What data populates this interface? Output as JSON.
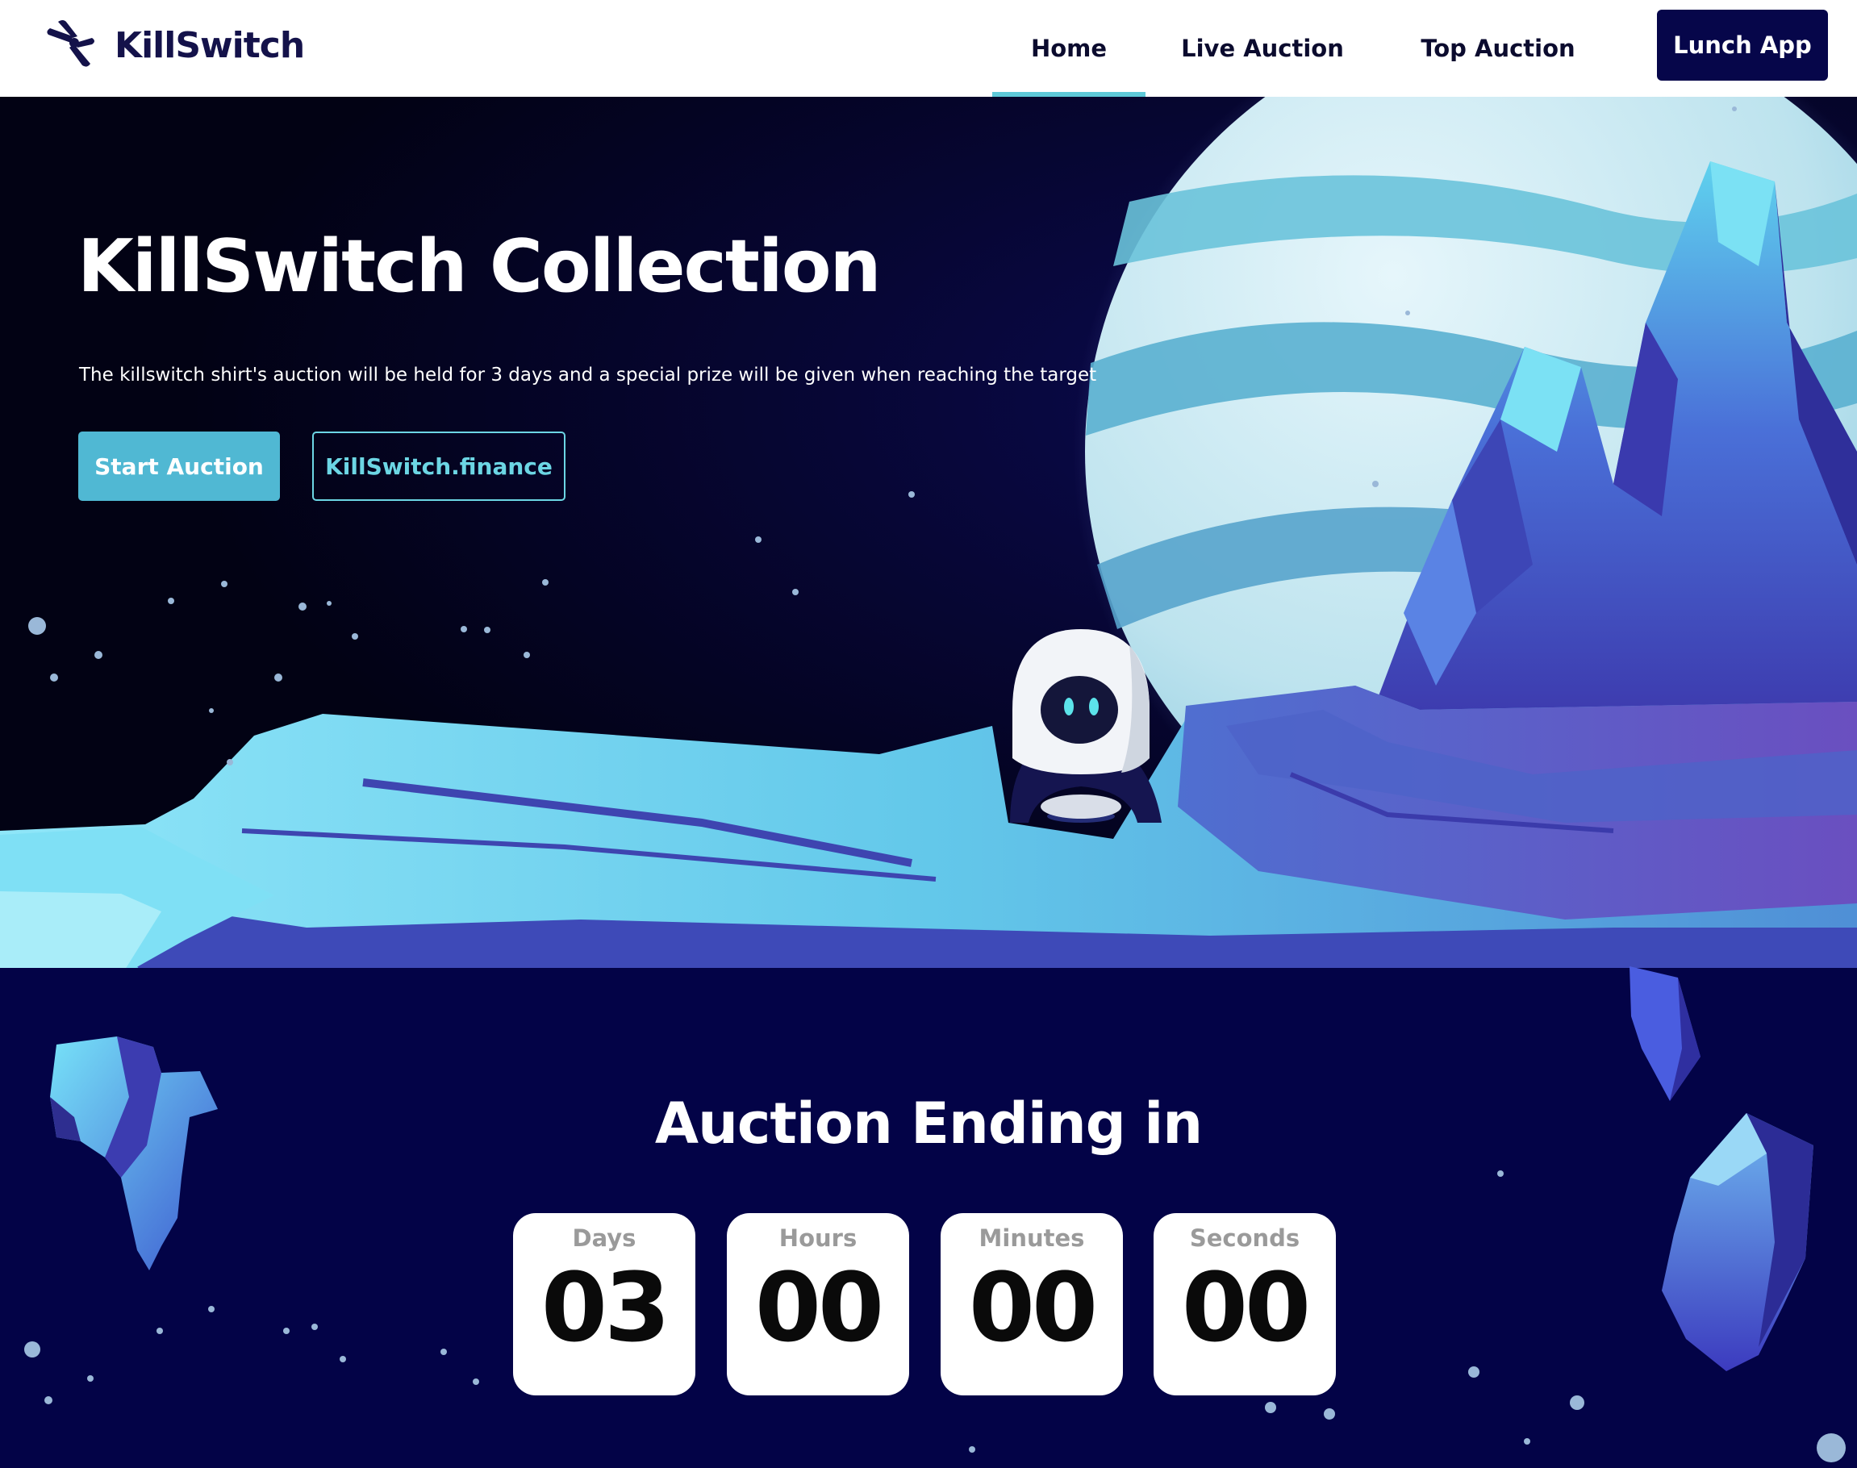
{
  "header": {
    "brand": "KillSwitch",
    "nav": [
      {
        "label": "Home",
        "active": true
      },
      {
        "label": "Live Auction",
        "active": false
      },
      {
        "label": "Top Auction",
        "active": false
      }
    ],
    "launch_label": "Lunch App"
  },
  "hero": {
    "title": "KillSwitch Collection",
    "subtitle": "The killswitch shirt's auction will be held for 3 days and a special prize will be given when reaching the target",
    "primary_button": "Start Auction",
    "secondary_button": "KillSwitch.finance"
  },
  "countdown": {
    "title": "Auction Ending in",
    "units": [
      {
        "label": "Days",
        "value": "03"
      },
      {
        "label": "Hours",
        "value": "00"
      },
      {
        "label": "Minutes",
        "value": "00"
      },
      {
        "label": "Seconds",
        "value": "00"
      }
    ]
  },
  "colors": {
    "header_bg": "#ffffff",
    "brand_navy": "#06064a",
    "accent_teal": "#50b8d3",
    "nav_active_underline": "#5ec9d8",
    "page_bg": "#030347",
    "sky": "#04043a"
  },
  "icons": {
    "brand_logo": "killswitch-propeller-icon"
  }
}
